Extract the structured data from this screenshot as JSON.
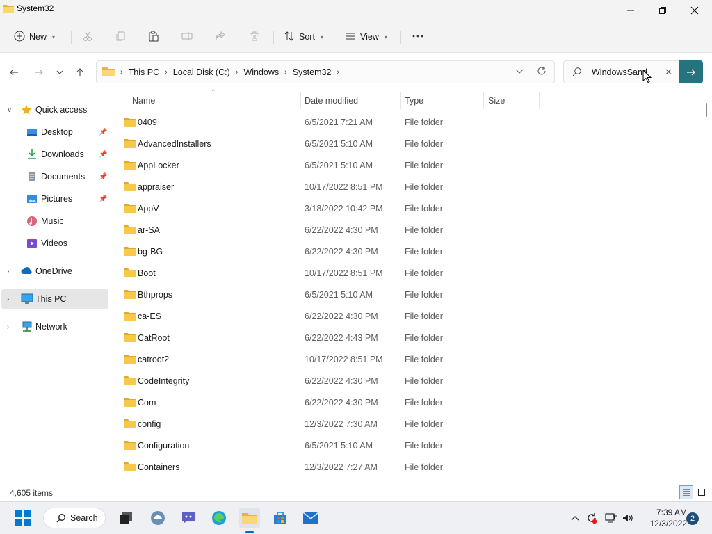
{
  "window": {
    "title": "System32"
  },
  "toolbar": {
    "new_label": "New",
    "sort_label": "Sort",
    "view_label": "View"
  },
  "address": {
    "crumbs": [
      "This PC",
      "Local Disk (C:)",
      "Windows",
      "System32"
    ]
  },
  "search": {
    "value": "WindowsSand"
  },
  "sidebar": {
    "quick_access": "Quick access",
    "items": [
      {
        "label": "Desktop"
      },
      {
        "label": "Downloads"
      },
      {
        "label": "Documents"
      },
      {
        "label": "Pictures"
      },
      {
        "label": "Music"
      },
      {
        "label": "Videos"
      }
    ],
    "onedrive": "OneDrive",
    "this_pc": "This PC",
    "network": "Network"
  },
  "columns": {
    "name": "Name",
    "date": "Date modified",
    "type": "Type",
    "size": "Size"
  },
  "files": [
    {
      "name": "0409",
      "date": "6/5/2021 7:21 AM",
      "type": "File folder"
    },
    {
      "name": "AdvancedInstallers",
      "date": "6/5/2021 5:10 AM",
      "type": "File folder"
    },
    {
      "name": "AppLocker",
      "date": "6/5/2021 5:10 AM",
      "type": "File folder"
    },
    {
      "name": "appraiser",
      "date": "10/17/2022 8:51 PM",
      "type": "File folder"
    },
    {
      "name": "AppV",
      "date": "3/18/2022 10:42 PM",
      "type": "File folder"
    },
    {
      "name": "ar-SA",
      "date": "6/22/2022 4:30 PM",
      "type": "File folder"
    },
    {
      "name": "bg-BG",
      "date": "6/22/2022 4:30 PM",
      "type": "File folder"
    },
    {
      "name": "Boot",
      "date": "10/17/2022 8:51 PM",
      "type": "File folder"
    },
    {
      "name": "Bthprops",
      "date": "6/5/2021 5:10 AM",
      "type": "File folder"
    },
    {
      "name": "ca-ES",
      "date": "6/22/2022 4:30 PM",
      "type": "File folder"
    },
    {
      "name": "CatRoot",
      "date": "6/22/2022 4:43 PM",
      "type": "File folder"
    },
    {
      "name": "catroot2",
      "date": "10/17/2022 8:51 PM",
      "type": "File folder"
    },
    {
      "name": "CodeIntegrity",
      "date": "6/22/2022 4:30 PM",
      "type": "File folder"
    },
    {
      "name": "Com",
      "date": "6/22/2022 4:30 PM",
      "type": "File folder"
    },
    {
      "name": "config",
      "date": "12/3/2022 7:30 AM",
      "type": "File folder"
    },
    {
      "name": "Configuration",
      "date": "6/5/2021 5:10 AM",
      "type": "File folder"
    },
    {
      "name": "Containers",
      "date": "12/3/2022 7:27 AM",
      "type": "File folder"
    }
  ],
  "status": {
    "item_count": "4,605 items"
  },
  "taskbar": {
    "search_label": "Search",
    "time": "7:39 AM",
    "date": "12/3/2022",
    "notifications": "2"
  },
  "colors": {
    "accent": "#24737e",
    "folder": "#f3c24d",
    "selected": "#e6e6e6"
  }
}
